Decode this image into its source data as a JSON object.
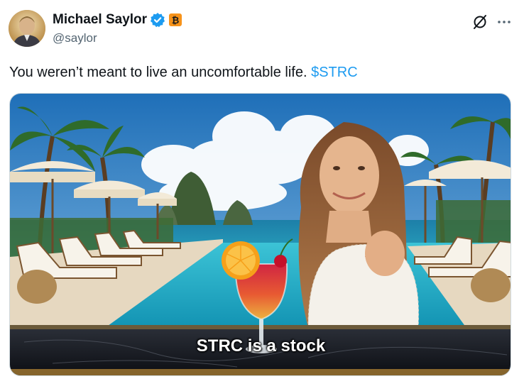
{
  "author": {
    "display_name": "Michael Saylor",
    "handle": "@saylor",
    "avatar_icon": "avatar-portrait",
    "verified_icon": "verified-checkmark-icon",
    "badge_icon": "bitcoin-badge-icon"
  },
  "actions": {
    "grok_icon": "grok-icon",
    "more_icon": "more-options-icon"
  },
  "tweet": {
    "text": "You weren’t meant to live an uncomfortable life.",
    "cashtag": "$STRC"
  },
  "media": {
    "caption": "STRC is a stock"
  },
  "colors": {
    "accent": "#1d9bf0",
    "verified": "#1d9bf0",
    "badge": "#f7931a",
    "text": "#0f1419",
    "secondary_text": "#536471"
  }
}
